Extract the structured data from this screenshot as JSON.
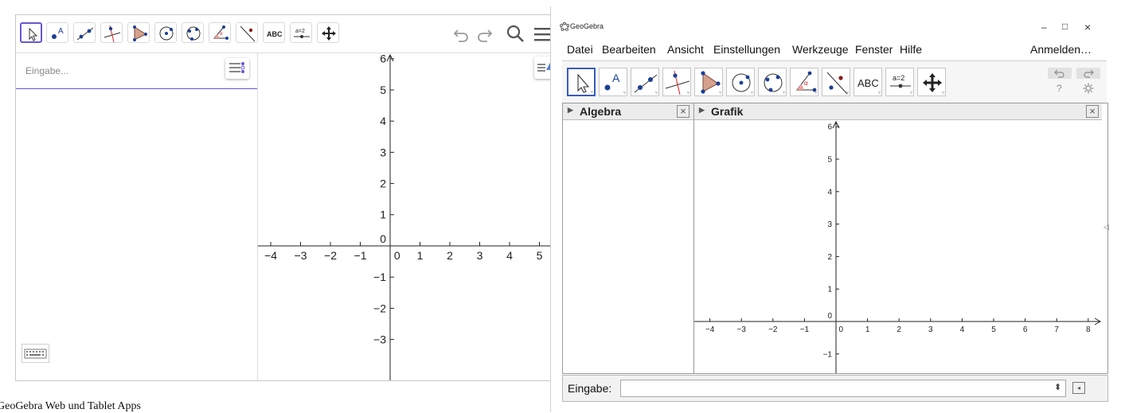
{
  "web_app": {
    "input_placeholder": "Eingabe...",
    "toolbar_tools": [
      "move-tool",
      "point-tool",
      "line-tool",
      "perpendicular-tool",
      "polygon-tool",
      "circle-center-tool",
      "circle-three-points-tool",
      "angle-tool",
      "reflect-tool",
      "text-tool",
      "slider-tool",
      "move-graphics-view-tool"
    ],
    "text_tool_label": "ABC",
    "slider_tool_label": "a=2",
    "right_icons": [
      "undo-icon",
      "redo-icon",
      "search-icon",
      "menu-icon"
    ],
    "graph": {
      "x_ticks": [
        "-4",
        "-3",
        "-2",
        "-1",
        "0",
        "1",
        "2",
        "3",
        "4",
        "5"
      ],
      "y_ticks": [
        "6",
        "5",
        "4",
        "3",
        "2",
        "1",
        "0",
        "-1",
        "-2",
        "-3"
      ]
    }
  },
  "desktop_app": {
    "window_title": "GeoGebra",
    "window_controls": [
      "–",
      "□",
      "×"
    ],
    "menu": [
      "Datei",
      "Bearbeiten",
      "Ansicht",
      "Einstellungen",
      "Werkzeuge",
      "Fenster",
      "Hilfe"
    ],
    "login": "Anmelden…",
    "text_tool_label": "ABC",
    "slider_tool_label": "a=2",
    "help_label": "?",
    "algebra_title": "Algebra",
    "graphics_title": "Grafik",
    "input_label": "Eingabe:",
    "graph": {
      "x_ticks": [
        "-4",
        "-3",
        "-2",
        "-1",
        "0",
        "1",
        "2",
        "3",
        "4",
        "5",
        "6",
        "7",
        "8"
      ],
      "y_ticks": [
        "6",
        "5",
        "4",
        "3",
        "2",
        "1",
        "0",
        "-1"
      ]
    }
  },
  "caption": "GeoGebra Web und Tablet Apps",
  "colors": {
    "accent_purple": "#6557d2",
    "desktop_select": "#3a5bbf",
    "point_blue": "#1c3f94",
    "polygon_fill": "#d6a18c",
    "red": "#d42020"
  }
}
